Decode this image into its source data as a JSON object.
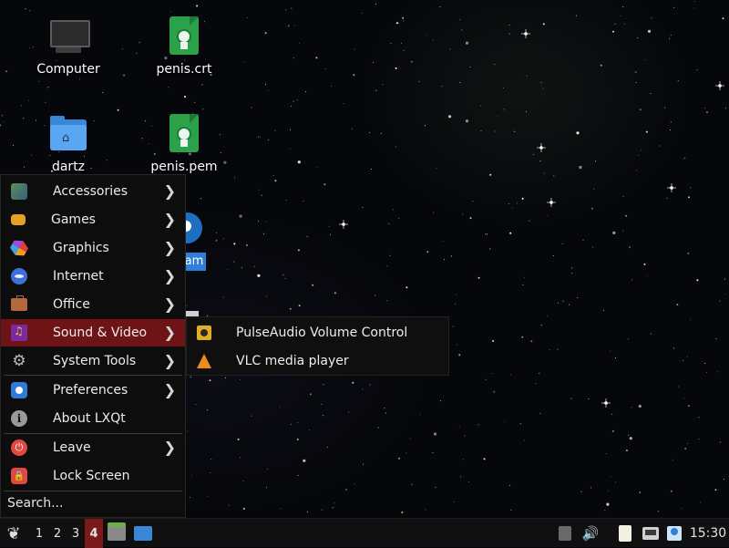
{
  "desktop": {
    "icons": [
      {
        "label": "Computer",
        "icon": "computer-icon"
      },
      {
        "label": "penis.crt",
        "icon": "certificate-icon"
      },
      {
        "label": "dartz",
        "icon": "home-folder-icon"
      },
      {
        "label": "penis.pem",
        "icon": "certificate-icon"
      },
      {
        "label": "am",
        "icon": "app-icon"
      }
    ]
  },
  "menu": {
    "items": [
      {
        "label": "Accessories",
        "icon": "accessories-icon",
        "has_submenu": true
      },
      {
        "label": "Games",
        "icon": "gamepad-icon",
        "has_submenu": true
      },
      {
        "label": "Graphics",
        "icon": "graphics-icon",
        "has_submenu": true
      },
      {
        "label": "Internet",
        "icon": "internet-icon",
        "has_submenu": true
      },
      {
        "label": "Office",
        "icon": "briefcase-icon",
        "has_submenu": true
      },
      {
        "label": "Sound & Video",
        "icon": "music-icon",
        "has_submenu": true,
        "active": true
      },
      {
        "label": "System Tools",
        "icon": "gear-icon",
        "has_submenu": true
      },
      {
        "label": "Preferences",
        "icon": "preferences-icon",
        "has_submenu": true
      },
      {
        "label": "About LXQt",
        "icon": "info-icon",
        "has_submenu": false
      },
      {
        "label": "Leave",
        "icon": "power-icon",
        "has_submenu": true
      },
      {
        "label": "Lock Screen",
        "icon": "lock-icon",
        "has_submenu": false
      }
    ],
    "search_placeholder": "Search...",
    "submenu_arrow": "❯",
    "active_color": "#6e1417"
  },
  "submenu": {
    "items": [
      {
        "label": "PulseAudio Volume Control",
        "icon": "speaker-icon"
      },
      {
        "label": "VLC media player",
        "icon": "vlc-cone-icon"
      }
    ]
  },
  "taskbar": {
    "start_icon": "lxqt-start-icon",
    "workspaces": [
      "1",
      "2",
      "3",
      "4"
    ],
    "active_workspace": "4",
    "quicklaunch": [
      "file-manager-icon",
      "show-desktop-icon"
    ],
    "tray": [
      "eject-icon",
      "volume-icon",
      "clipboard-icon",
      "network-icon",
      "update-notifier-icon"
    ],
    "volume_glyph": "🔊",
    "clock": "15:30"
  }
}
